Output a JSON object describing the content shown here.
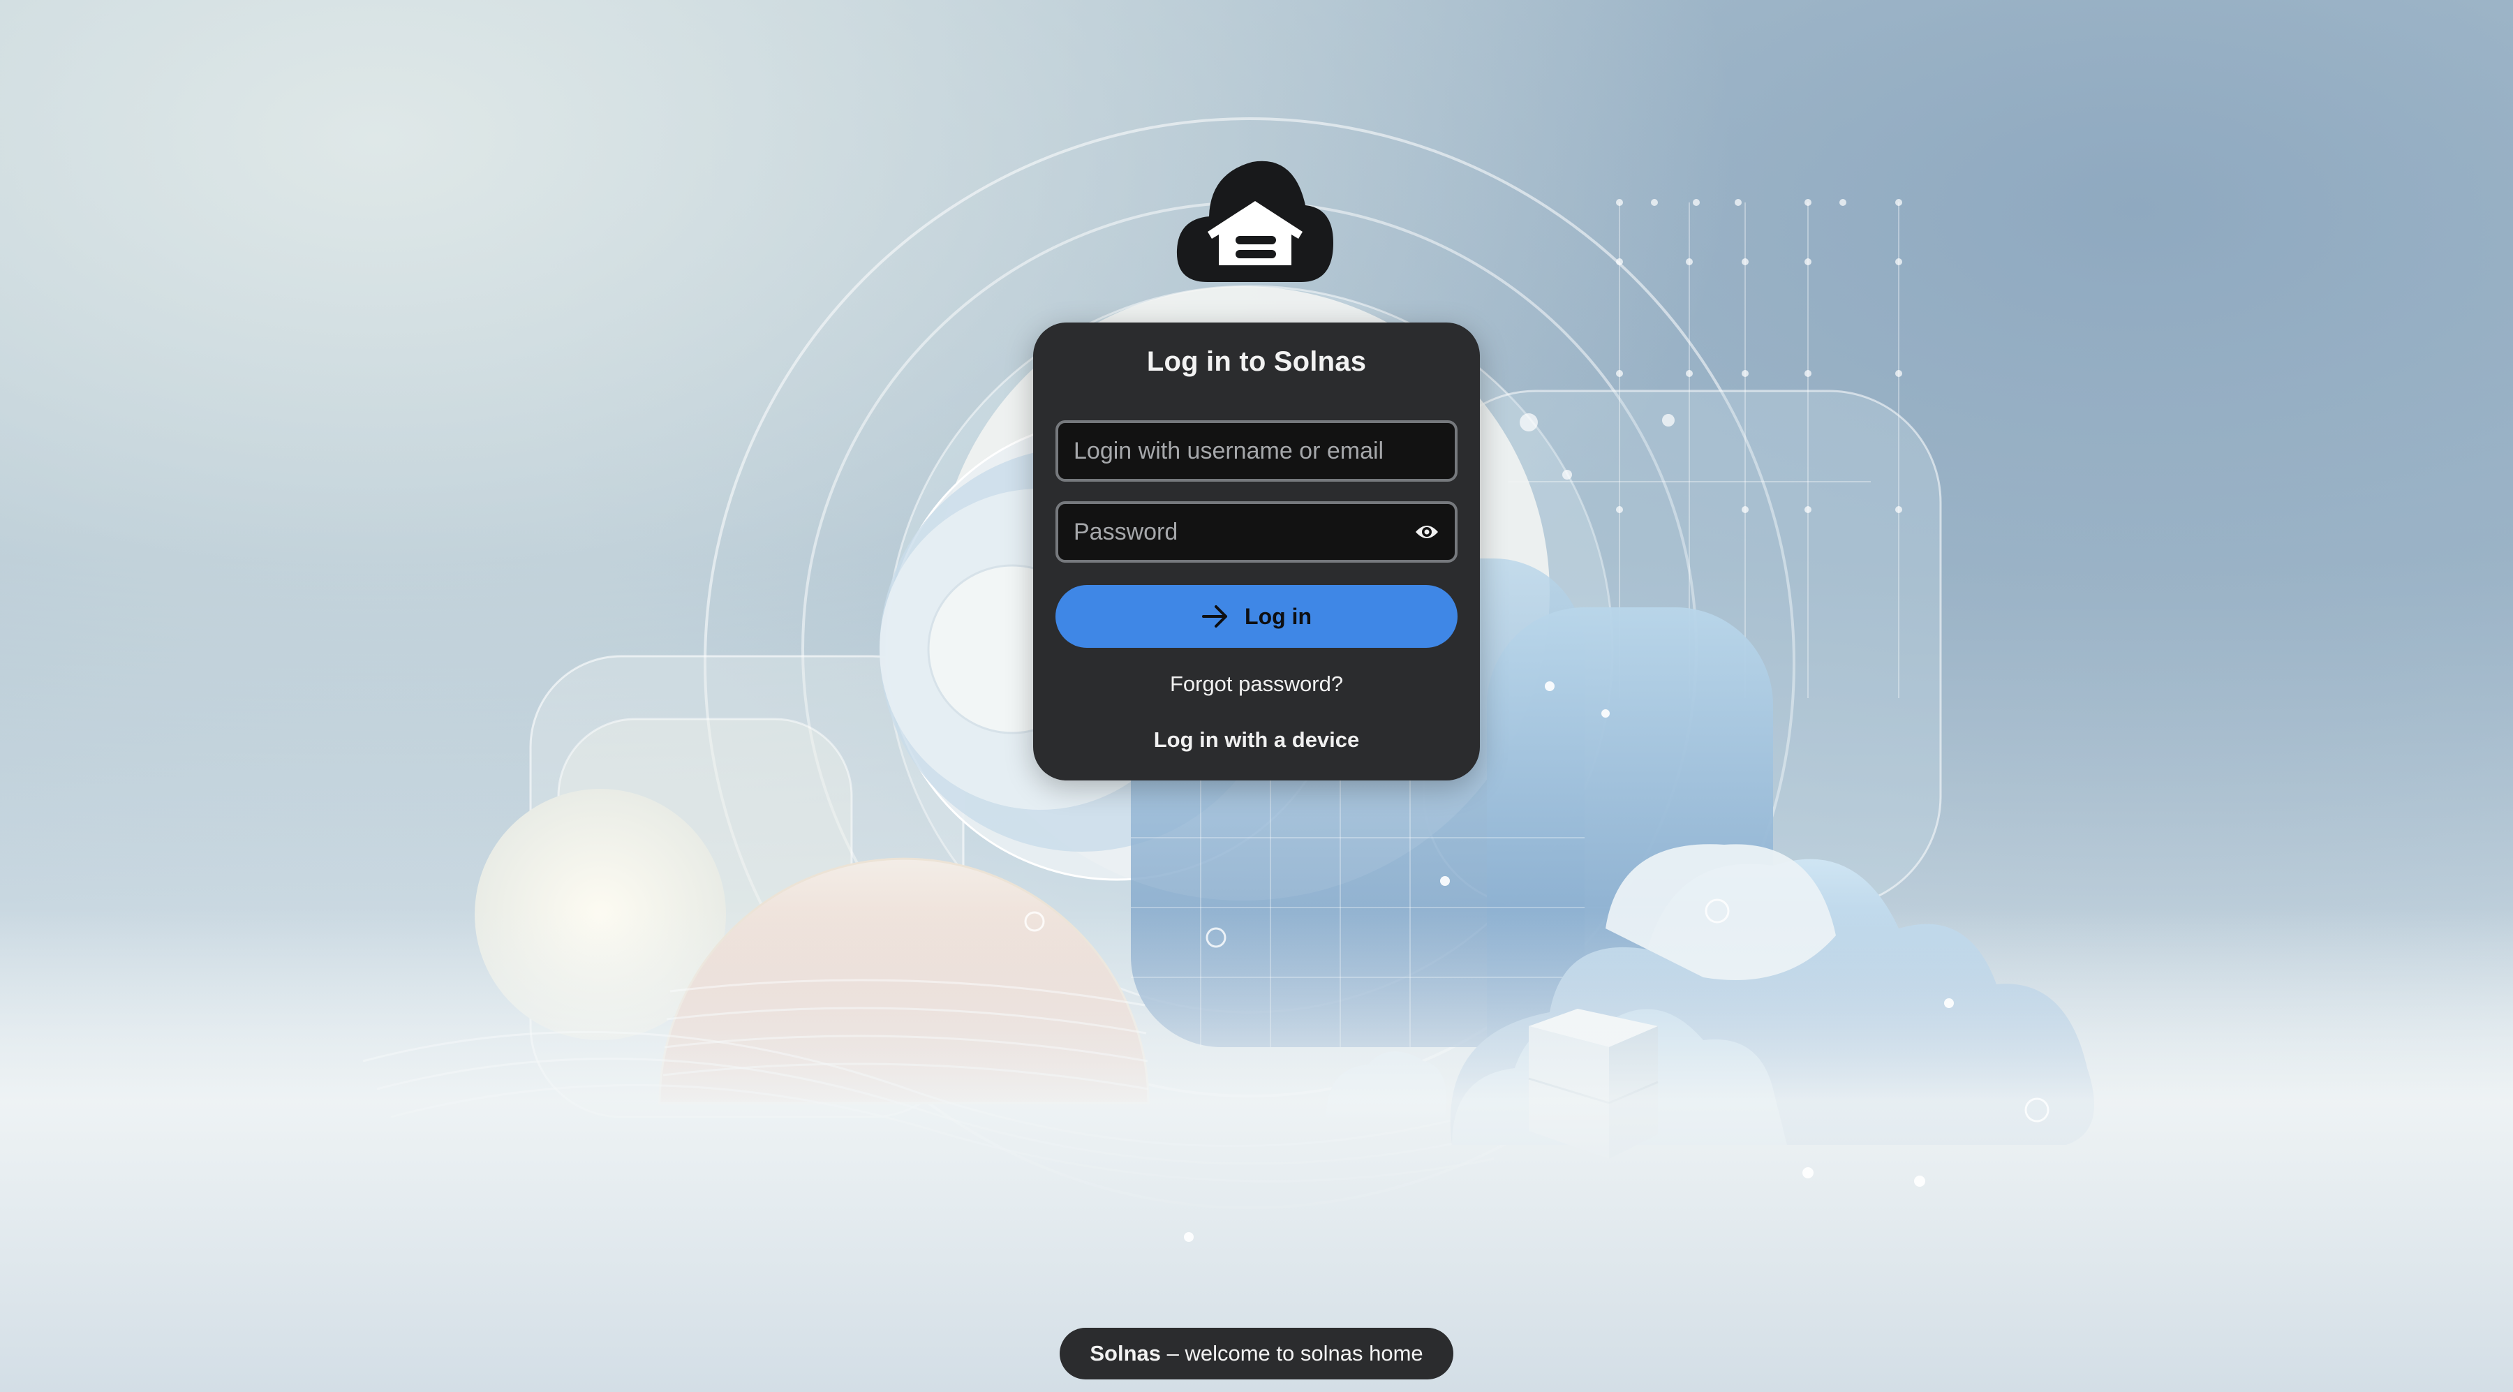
{
  "login_card": {
    "title": "Log in to Solnas",
    "username_placeholder": "Login with username or email",
    "password_placeholder": "Password",
    "login_button_label": "Log in",
    "forgot_password_link": "Forgot password?",
    "device_login_link": "Log in with a device"
  },
  "footer": {
    "brand": "Solnas",
    "tagline": " – welcome to solnas home"
  },
  "icons": {
    "logo": "cloud-house-logo",
    "password_toggle": "eye-icon",
    "login_arrow": "arrow-right-icon"
  },
  "colors": {
    "card_background": "#2b2c2e",
    "primary_button": "#3f87e6",
    "input_background": "#121212",
    "input_border": "#76797d"
  }
}
